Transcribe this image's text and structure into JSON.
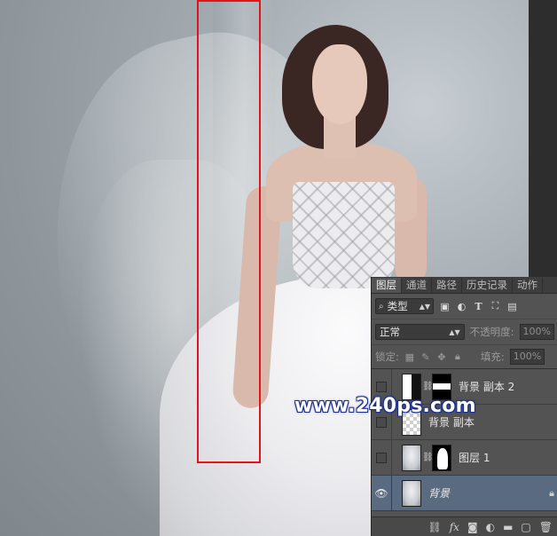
{
  "panel": {
    "tabs": [
      {
        "label": "图层",
        "active": true
      },
      {
        "label": "通道",
        "active": false
      },
      {
        "label": "路径",
        "active": false
      },
      {
        "label": "历史记录",
        "active": false
      },
      {
        "label": "动作",
        "active": false
      }
    ],
    "filter": {
      "label": "类型"
    },
    "blend": {
      "mode": "正常",
      "opacity_label": "不透明度:",
      "opacity_value": "100%"
    },
    "lock": {
      "label": "锁定:",
      "fill_label": "填充:",
      "fill_value": "100%"
    },
    "layers": [
      {
        "name": "背景 副本 2",
        "visible": false,
        "has_mask": true,
        "selected": false
      },
      {
        "name": "背景 副本",
        "visible": false,
        "has_mask": false,
        "selected": false
      },
      {
        "name": "图层 1",
        "visible": false,
        "has_mask": true,
        "selected": false
      },
      {
        "name": "背景",
        "visible": true,
        "has_mask": false,
        "selected": true,
        "locked": true
      }
    ]
  },
  "watermark": "www.240ps.com",
  "icons": {
    "eye": "eye-icon",
    "chain": "chain-link-icon",
    "lock": "lock-icon"
  },
  "colors": {
    "selection_box": "#e0141c",
    "panel_bg": "#535353",
    "selected_layer": "#5a6a80"
  }
}
